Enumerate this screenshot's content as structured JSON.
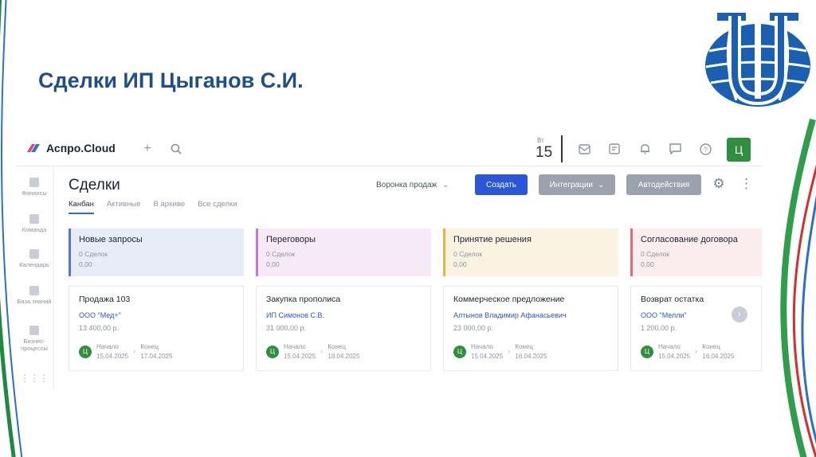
{
  "slide_title": "Сделки ИП Цыганов С.И.",
  "brand": {
    "name": "Аспро.Cloud"
  },
  "topbar": {
    "date_weekday": "Вт",
    "date_day": "15",
    "user_initial": "Ц"
  },
  "sidebar": {
    "items": [
      {
        "label": "Финансы",
        "icon": "finance-icon"
      },
      {
        "label": "Команда",
        "icon": "team-icon"
      },
      {
        "label": "Календарь",
        "icon": "calendar-icon"
      },
      {
        "label": "База знаний",
        "icon": "knowledge-base-icon"
      },
      {
        "label": "Бизнес-процессы",
        "icon": "business-process-icon"
      }
    ]
  },
  "page": {
    "title": "Сделки",
    "tabs": [
      {
        "label": "Канбан",
        "active": true
      },
      {
        "label": "Активные",
        "active": false
      },
      {
        "label": "В архиве",
        "active": false
      },
      {
        "label": "Все сделки",
        "active": false
      }
    ],
    "funnel_label": "Воронка продаж",
    "create_label": "Создать",
    "integrations_label": "Интеграции",
    "auto_actions_label": "Автодействия"
  },
  "colors": {
    "accent": "#2b56d8",
    "success": "#2f8f3e",
    "stage1": "#5a73d6",
    "stage2": "#c27ad0",
    "stage3": "#e2b53b",
    "stage4": "#e06a7a"
  },
  "stages": [
    {
      "title": "Новые запросы",
      "count": "0 Сделок",
      "sum": "0,00"
    },
    {
      "title": "Переговоры",
      "count": "0 Сделок",
      "sum": "0,00"
    },
    {
      "title": "Принятие решения",
      "count": "0 Сделок",
      "sum": "0,00"
    },
    {
      "title": "Согласование договора",
      "count": "0 Сделок",
      "sum": "0,00"
    }
  ],
  "cards": [
    {
      "title": "Продажа 103",
      "company": "ООО \"Мед+\"",
      "amount": "13 400,00 р.",
      "start_label": "Начало",
      "start_date": "15.04.2025",
      "end_label": "Конец",
      "end_date": "17.04.2025",
      "avatar": "Ц"
    },
    {
      "title": "Закупка прополиса",
      "company": "ИП Симонов С.В.",
      "amount": "31 000,00 р.",
      "start_label": "Начало",
      "start_date": "15.04.2025",
      "end_label": "Конец",
      "end_date": "18.04.2025",
      "avatar": "Ц"
    },
    {
      "title": "Коммерческое предложение",
      "company": "Алтынов Владимир Афанасьевич",
      "amount": "23 000,00 р.",
      "start_label": "Начало",
      "start_date": "15.04.2025",
      "end_label": "Конец",
      "end_date": "16.04.2025",
      "avatar": "Ц"
    },
    {
      "title": "Возврат остатка",
      "company": "ООО \"Мелли\"",
      "amount": "1 200,00 р.",
      "start_label": "Начало",
      "start_date": "15.04.2025",
      "end_label": "Конец",
      "end_date": "16.04.2025",
      "avatar": "Ц"
    }
  ]
}
